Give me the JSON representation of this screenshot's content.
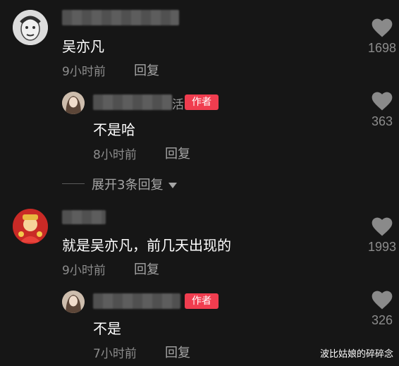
{
  "comments": [
    {
      "avatar_icon": "man-face-avatar",
      "text": "吴亦凡",
      "time": "9小时前",
      "reply_label": "回复",
      "likes": "1698"
    },
    {
      "avatar_icon": "author-avatar",
      "username_tail": "活",
      "author_tag": "作者",
      "text": "不是哈",
      "time": "8小时前",
      "reply_label": "回复",
      "likes": "363"
    },
    {
      "expand_label": "展开3条回复"
    },
    {
      "avatar_icon": "caishen-avatar",
      "text": "就是吴亦凡，前几天出现的",
      "time": "9小时前",
      "reply_label": "回复",
      "likes": "1993"
    },
    {
      "avatar_icon": "author-avatar",
      "author_tag": "作者",
      "text": "不是",
      "time": "7小时前",
      "reply_label": "回复",
      "likes": "326"
    }
  ],
  "watermark": "波比姑娘的碎碎念",
  "colors": {
    "background": "#161616",
    "author_tag": "#f03d4f",
    "meta_text": "#8c8c8c",
    "heart": "#8a8a8a"
  }
}
